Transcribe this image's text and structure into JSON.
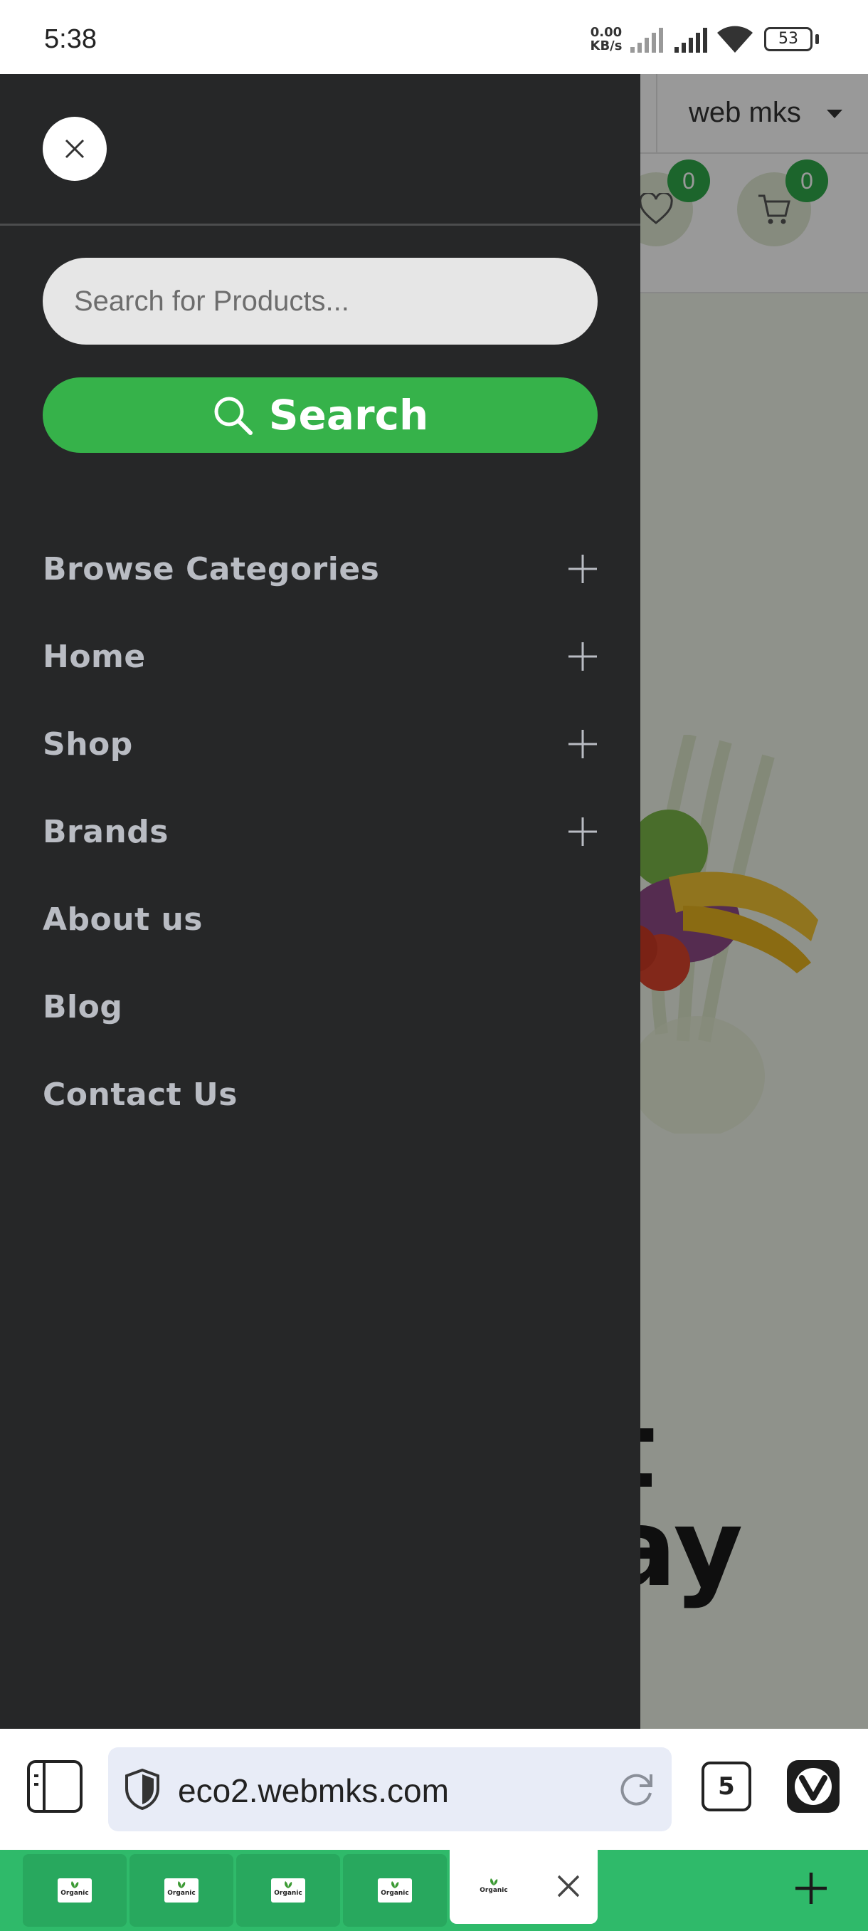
{
  "status_bar": {
    "time": "5:38",
    "net_speed_value": "0.00",
    "net_speed_unit": "KB/s",
    "battery": "53"
  },
  "page": {
    "language": "web mks",
    "wishlist_count": "0",
    "cart_count": "0",
    "hero_heading_line1": "t",
    "hero_heading_line2": "ay"
  },
  "drawer": {
    "search_placeholder": "Search for Products...",
    "search_button": "Search",
    "menu": [
      {
        "label": "Browse Categories",
        "expandable": true
      },
      {
        "label": "Home",
        "expandable": true
      },
      {
        "label": "Shop",
        "expandable": true
      },
      {
        "label": "Brands",
        "expandable": true
      },
      {
        "label": "About us",
        "expandable": false
      },
      {
        "label": "Blog",
        "expandable": false
      },
      {
        "label": "Contact Us",
        "expandable": false
      }
    ]
  },
  "browser": {
    "url": "eco2.webmks.com",
    "tab_count": "5",
    "favicon_text": "Organic"
  },
  "colors": {
    "accent_green": "#36b24a",
    "drawer_bg": "#262728",
    "tab_strip": "#2fba6a"
  },
  "icons": [
    "close-icon",
    "search-icon",
    "plus-icon",
    "heart-icon",
    "cart-icon",
    "shield-icon",
    "reload-icon",
    "vivaldi-logo",
    "panel-icon"
  ]
}
